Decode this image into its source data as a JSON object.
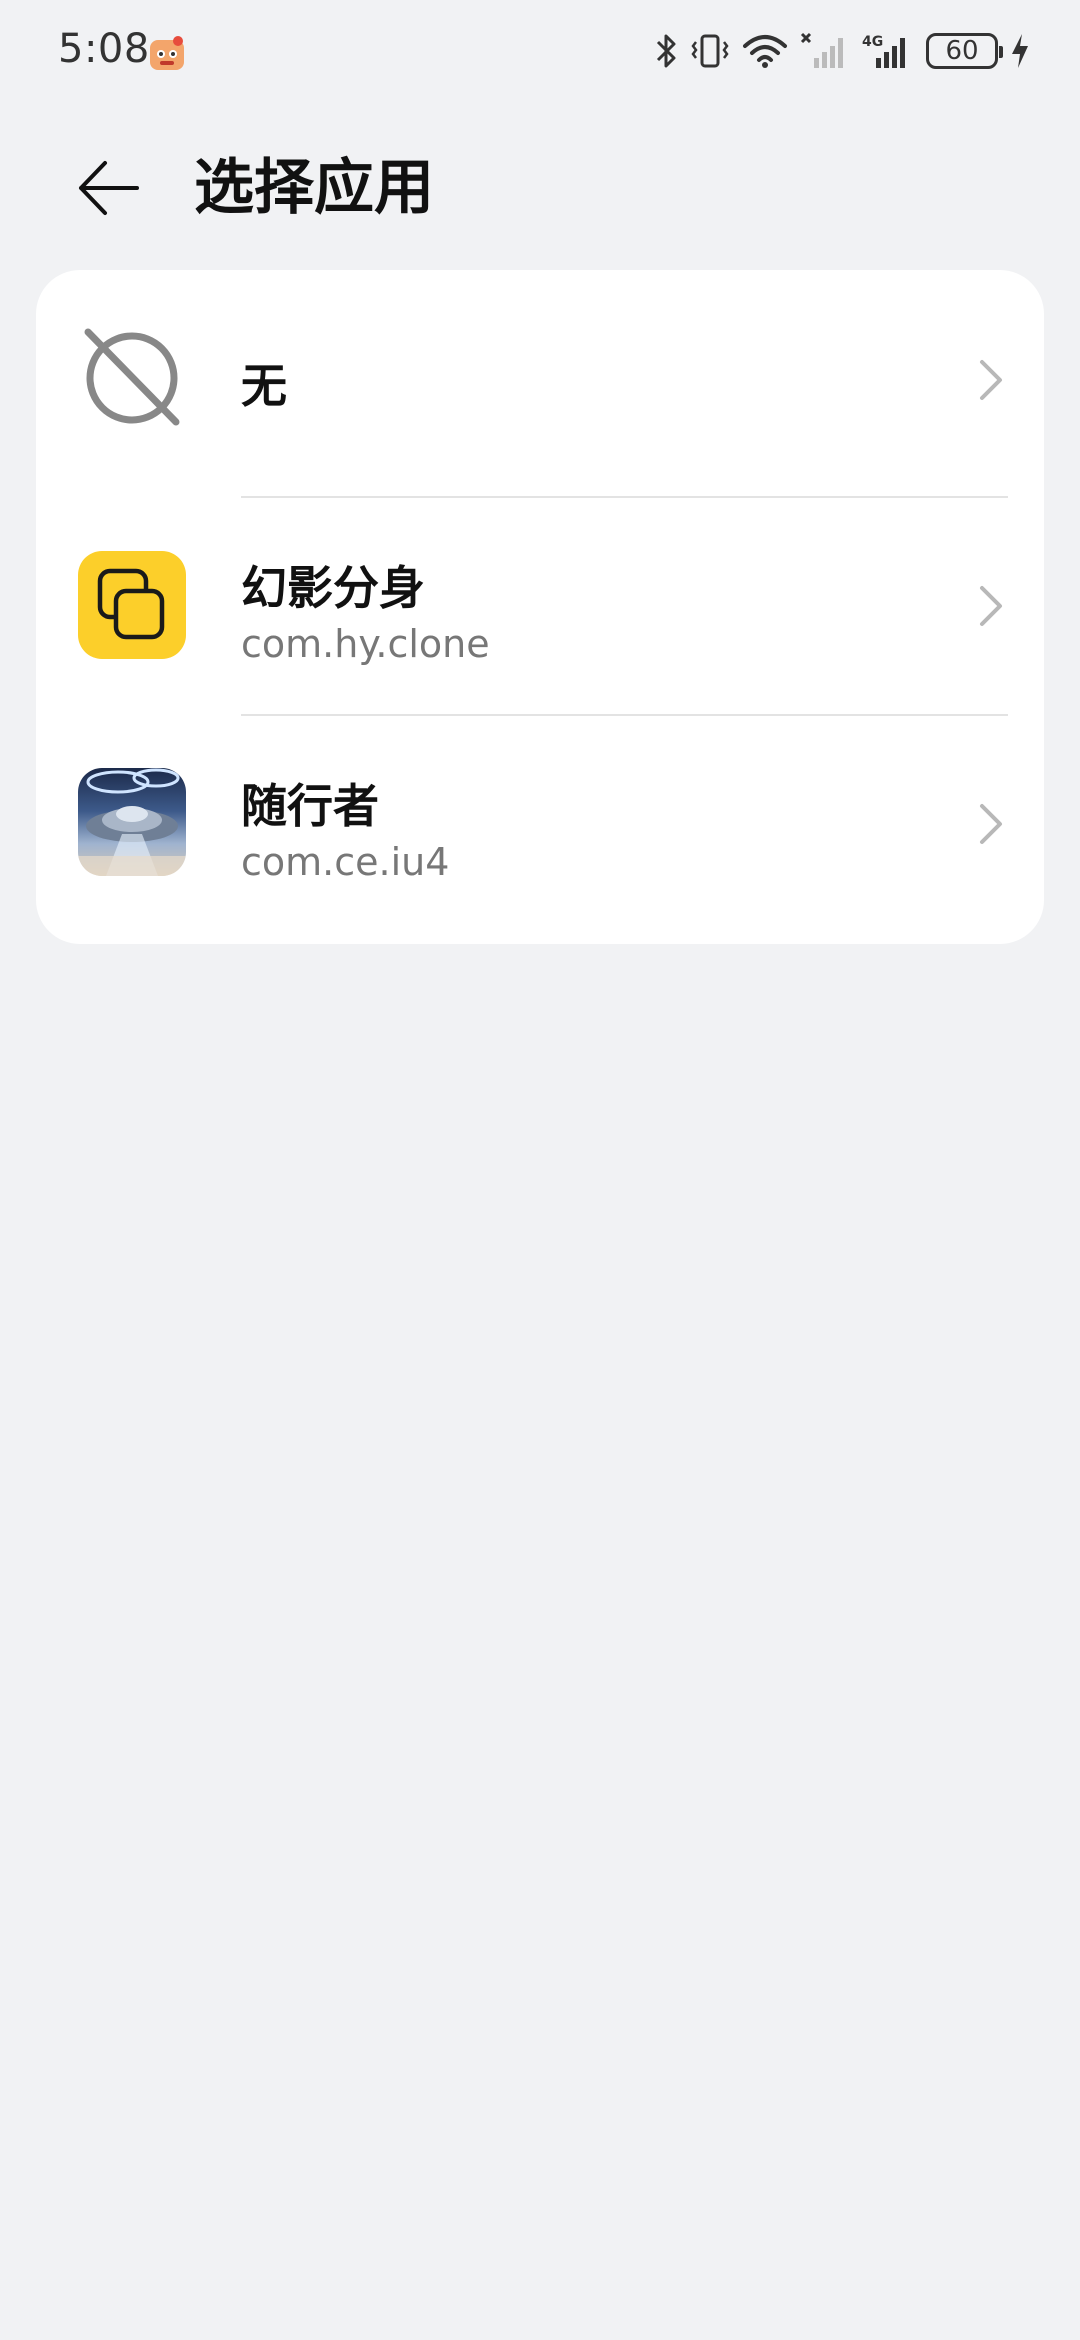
{
  "status_bar": {
    "time": "5:08",
    "battery_level": "60",
    "icons": [
      "app-notification-icon",
      "bluetooth-icon",
      "vibrate-icon",
      "wifi-icon",
      "signal-no-sim-icon",
      "signal-4g-icon",
      "battery-icon",
      "charging-icon"
    ]
  },
  "header": {
    "title": "选择应用",
    "back_icon": "arrow-left-icon"
  },
  "apps": [
    {
      "name": "无",
      "package": "",
      "icon": "none-slash-icon"
    },
    {
      "name": "幻影分身",
      "package": "com.hy.clone",
      "icon": "clone-app-icon"
    },
    {
      "name": "随行者",
      "package": "com.ce.iu4",
      "icon": "ufo-app-icon"
    }
  ],
  "colors": {
    "background": "#f1f2f4",
    "card": "#ffffff",
    "clone_icon_bg": "#fccf2a",
    "secondary_text": "#777777"
  }
}
